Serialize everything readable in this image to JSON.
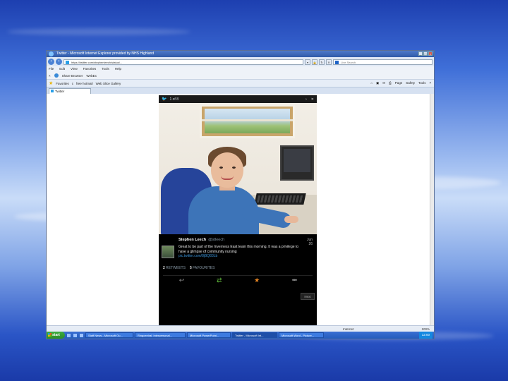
{
  "window": {
    "title": "Twitter - Microsoft Internet Explorer provided by NHS Highland",
    "address": "https://twitter.com/stephenleech/status/...",
    "search_placeholder": "Live Search"
  },
  "menu": [
    "File",
    "Edit",
    "View",
    "Favorites",
    "Tools",
    "Help"
  ],
  "toolbar2": {
    "share_label": "Share Browser",
    "webex_label": "WebEx"
  },
  "favorites": {
    "favorites_label": "Favorites",
    "item1": "c",
    "item2": "free hotmail",
    "item3": "Web Slice Gallery",
    "right_items": [
      "Page",
      "Safety",
      "Tools"
    ]
  },
  "tab": {
    "label": "Twitter"
  },
  "overlay": {
    "counter": "1 of 8",
    "tweet": {
      "author": "Stephen Leech",
      "handle": "@stleech",
      "date_line1": "Jun",
      "date_line2": "26",
      "text": "Great to be part of the Inverness East team this morning. It was a privilege to have a glimpse of community nursing",
      "link": "pic.twitter.com/8jBQ83Lb",
      "retweets_count": "2",
      "retweets_label": "RETWEETS",
      "favourites_count": "5",
      "favourites_label": "FAVOURITES"
    },
    "next_label": "Next"
  },
  "status": {
    "zone": "Internet",
    "zoom": "100%"
  },
  "taskbar": {
    "start_label": "start",
    "buttons": [
      "Staff News - Microsoft Ou...",
      "Ringcentral: interpersonal...",
      "Microsoft PowerPoint...",
      "Twitter - Microsoft Int...",
      "Microsoft Word - Picture..."
    ],
    "clock": "12:00"
  }
}
